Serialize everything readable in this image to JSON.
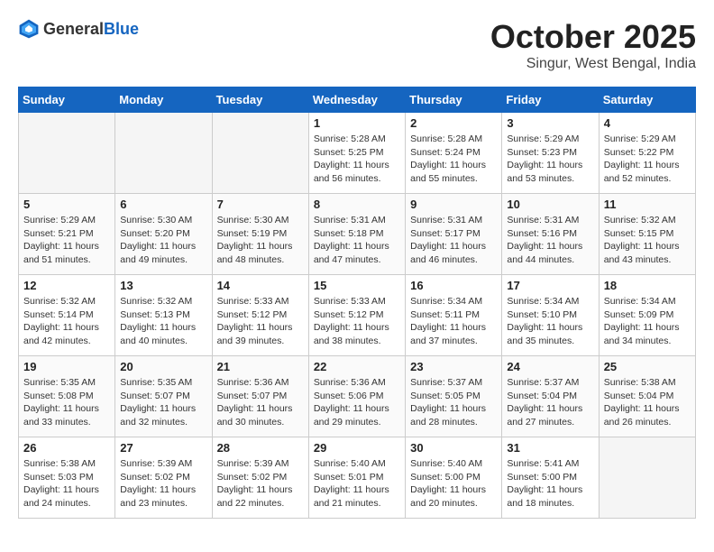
{
  "header": {
    "logo_general": "General",
    "logo_blue": "Blue",
    "month": "October 2025",
    "location": "Singur, West Bengal, India"
  },
  "weekdays": [
    "Sunday",
    "Monday",
    "Tuesday",
    "Wednesday",
    "Thursday",
    "Friday",
    "Saturday"
  ],
  "weeks": [
    [
      {
        "day": "",
        "sunrise": "",
        "sunset": "",
        "daylight": ""
      },
      {
        "day": "",
        "sunrise": "",
        "sunset": "",
        "daylight": ""
      },
      {
        "day": "",
        "sunrise": "",
        "sunset": "",
        "daylight": ""
      },
      {
        "day": "1",
        "sunrise": "Sunrise: 5:28 AM",
        "sunset": "Sunset: 5:25 PM",
        "daylight": "Daylight: 11 hours and 56 minutes."
      },
      {
        "day": "2",
        "sunrise": "Sunrise: 5:28 AM",
        "sunset": "Sunset: 5:24 PM",
        "daylight": "Daylight: 11 hours and 55 minutes."
      },
      {
        "day": "3",
        "sunrise": "Sunrise: 5:29 AM",
        "sunset": "Sunset: 5:23 PM",
        "daylight": "Daylight: 11 hours and 53 minutes."
      },
      {
        "day": "4",
        "sunrise": "Sunrise: 5:29 AM",
        "sunset": "Sunset: 5:22 PM",
        "daylight": "Daylight: 11 hours and 52 minutes."
      }
    ],
    [
      {
        "day": "5",
        "sunrise": "Sunrise: 5:29 AM",
        "sunset": "Sunset: 5:21 PM",
        "daylight": "Daylight: 11 hours and 51 minutes."
      },
      {
        "day": "6",
        "sunrise": "Sunrise: 5:30 AM",
        "sunset": "Sunset: 5:20 PM",
        "daylight": "Daylight: 11 hours and 49 minutes."
      },
      {
        "day": "7",
        "sunrise": "Sunrise: 5:30 AM",
        "sunset": "Sunset: 5:19 PM",
        "daylight": "Daylight: 11 hours and 48 minutes."
      },
      {
        "day": "8",
        "sunrise": "Sunrise: 5:31 AM",
        "sunset": "Sunset: 5:18 PM",
        "daylight": "Daylight: 11 hours and 47 minutes."
      },
      {
        "day": "9",
        "sunrise": "Sunrise: 5:31 AM",
        "sunset": "Sunset: 5:17 PM",
        "daylight": "Daylight: 11 hours and 46 minutes."
      },
      {
        "day": "10",
        "sunrise": "Sunrise: 5:31 AM",
        "sunset": "Sunset: 5:16 PM",
        "daylight": "Daylight: 11 hours and 44 minutes."
      },
      {
        "day": "11",
        "sunrise": "Sunrise: 5:32 AM",
        "sunset": "Sunset: 5:15 PM",
        "daylight": "Daylight: 11 hours and 43 minutes."
      }
    ],
    [
      {
        "day": "12",
        "sunrise": "Sunrise: 5:32 AM",
        "sunset": "Sunset: 5:14 PM",
        "daylight": "Daylight: 11 hours and 42 minutes."
      },
      {
        "day": "13",
        "sunrise": "Sunrise: 5:32 AM",
        "sunset": "Sunset: 5:13 PM",
        "daylight": "Daylight: 11 hours and 40 minutes."
      },
      {
        "day": "14",
        "sunrise": "Sunrise: 5:33 AM",
        "sunset": "Sunset: 5:12 PM",
        "daylight": "Daylight: 11 hours and 39 minutes."
      },
      {
        "day": "15",
        "sunrise": "Sunrise: 5:33 AM",
        "sunset": "Sunset: 5:12 PM",
        "daylight": "Daylight: 11 hours and 38 minutes."
      },
      {
        "day": "16",
        "sunrise": "Sunrise: 5:34 AM",
        "sunset": "Sunset: 5:11 PM",
        "daylight": "Daylight: 11 hours and 37 minutes."
      },
      {
        "day": "17",
        "sunrise": "Sunrise: 5:34 AM",
        "sunset": "Sunset: 5:10 PM",
        "daylight": "Daylight: 11 hours and 35 minutes."
      },
      {
        "day": "18",
        "sunrise": "Sunrise: 5:34 AM",
        "sunset": "Sunset: 5:09 PM",
        "daylight": "Daylight: 11 hours and 34 minutes."
      }
    ],
    [
      {
        "day": "19",
        "sunrise": "Sunrise: 5:35 AM",
        "sunset": "Sunset: 5:08 PM",
        "daylight": "Daylight: 11 hours and 33 minutes."
      },
      {
        "day": "20",
        "sunrise": "Sunrise: 5:35 AM",
        "sunset": "Sunset: 5:07 PM",
        "daylight": "Daylight: 11 hours and 32 minutes."
      },
      {
        "day": "21",
        "sunrise": "Sunrise: 5:36 AM",
        "sunset": "Sunset: 5:07 PM",
        "daylight": "Daylight: 11 hours and 30 minutes."
      },
      {
        "day": "22",
        "sunrise": "Sunrise: 5:36 AM",
        "sunset": "Sunset: 5:06 PM",
        "daylight": "Daylight: 11 hours and 29 minutes."
      },
      {
        "day": "23",
        "sunrise": "Sunrise: 5:37 AM",
        "sunset": "Sunset: 5:05 PM",
        "daylight": "Daylight: 11 hours and 28 minutes."
      },
      {
        "day": "24",
        "sunrise": "Sunrise: 5:37 AM",
        "sunset": "Sunset: 5:04 PM",
        "daylight": "Daylight: 11 hours and 27 minutes."
      },
      {
        "day": "25",
        "sunrise": "Sunrise: 5:38 AM",
        "sunset": "Sunset: 5:04 PM",
        "daylight": "Daylight: 11 hours and 26 minutes."
      }
    ],
    [
      {
        "day": "26",
        "sunrise": "Sunrise: 5:38 AM",
        "sunset": "Sunset: 5:03 PM",
        "daylight": "Daylight: 11 hours and 24 minutes."
      },
      {
        "day": "27",
        "sunrise": "Sunrise: 5:39 AM",
        "sunset": "Sunset: 5:02 PM",
        "daylight": "Daylight: 11 hours and 23 minutes."
      },
      {
        "day": "28",
        "sunrise": "Sunrise: 5:39 AM",
        "sunset": "Sunset: 5:02 PM",
        "daylight": "Daylight: 11 hours and 22 minutes."
      },
      {
        "day": "29",
        "sunrise": "Sunrise: 5:40 AM",
        "sunset": "Sunset: 5:01 PM",
        "daylight": "Daylight: 11 hours and 21 minutes."
      },
      {
        "day": "30",
        "sunrise": "Sunrise: 5:40 AM",
        "sunset": "Sunset: 5:00 PM",
        "daylight": "Daylight: 11 hours and 20 minutes."
      },
      {
        "day": "31",
        "sunrise": "Sunrise: 5:41 AM",
        "sunset": "Sunset: 5:00 PM",
        "daylight": "Daylight: 11 hours and 18 minutes."
      },
      {
        "day": "",
        "sunrise": "",
        "sunset": "",
        "daylight": ""
      }
    ]
  ]
}
